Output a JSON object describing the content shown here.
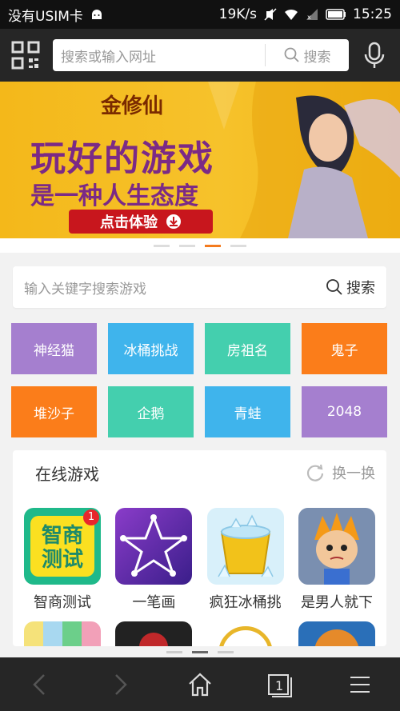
{
  "status_bar": {
    "carrier": "没有USIM卡",
    "speed": "19K/s",
    "time": "15:25"
  },
  "top_bar": {
    "search_placeholder": "搜索或输入网址",
    "search_button": "搜索"
  },
  "banner": {
    "logo_text": "金修仙",
    "line1": "玩好的游戏",
    "line2": "是一种人生态度",
    "button": "点击体验",
    "colors": {
      "purple": "#7b2a86",
      "button_red": "#c8161d"
    }
  },
  "game_search": {
    "placeholder": "输入关键字搜索游戏",
    "button": "搜索"
  },
  "tiles": [
    {
      "label": "神经猫",
      "color": "#a57fcf"
    },
    {
      "label": "冰桶挑战",
      "color": "#3fb4ec"
    },
    {
      "label": "房祖名",
      "color": "#44cfae"
    },
    {
      "label": "鬼子",
      "color": "#fb7d1a"
    },
    {
      "label": "堆沙子",
      "color": "#fb7d1a"
    },
    {
      "label": "企鹅",
      "color": "#44cfae"
    },
    {
      "label": "青蛙",
      "color": "#3fb4ec"
    },
    {
      "label": "2048",
      "color": "#a57fcf"
    }
  ],
  "online_games": {
    "title": "在线游戏",
    "refresh": "换一换",
    "games": [
      {
        "name": "智商测试",
        "icon": "iq-test-icon",
        "badge": "1",
        "icon_text": "智商\n测试"
      },
      {
        "name": "一笔画",
        "icon": "star-drawing-icon"
      },
      {
        "name": "疯狂冰桶挑",
        "icon": "ice-bucket-icon"
      },
      {
        "name": "是男人就下",
        "icon": "cartoon-boy-icon"
      }
    ]
  }
}
